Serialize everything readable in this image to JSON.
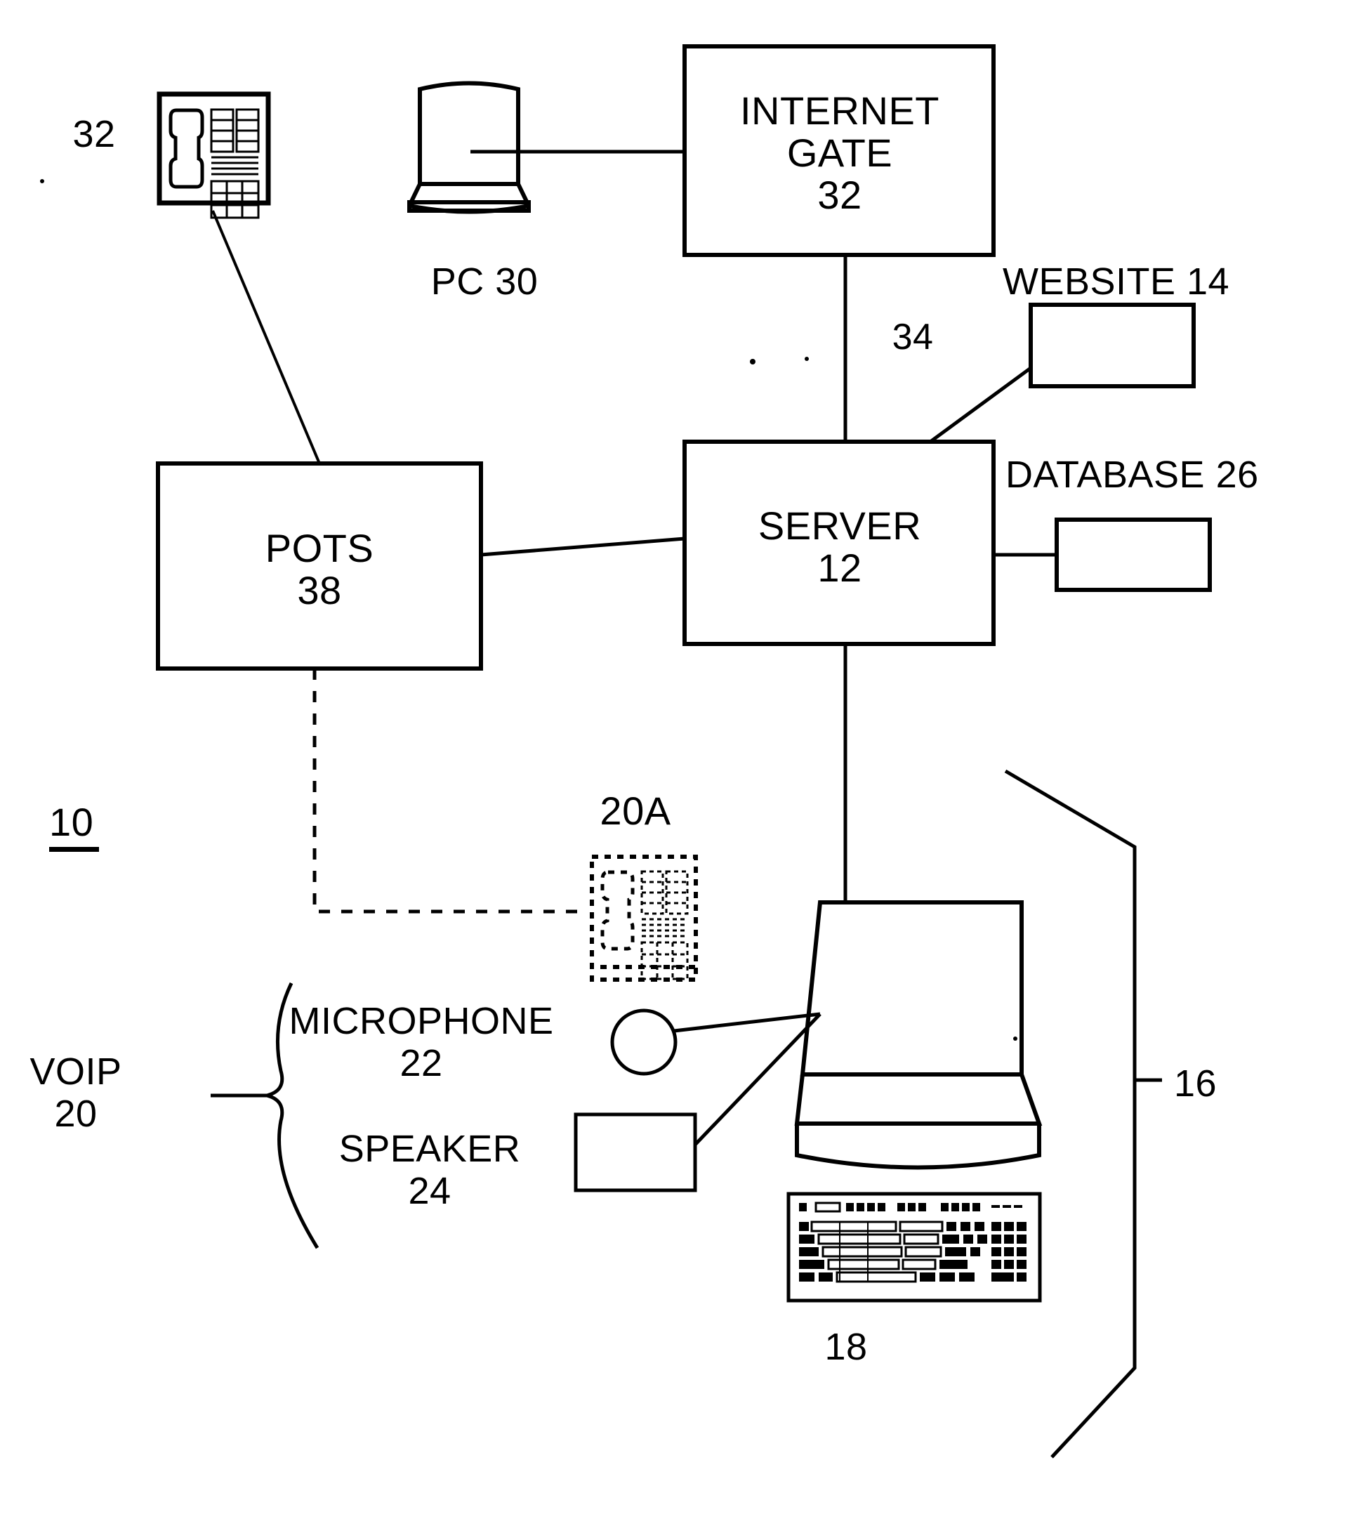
{
  "figure": {
    "reference_numeral": "10",
    "nodes": {
      "internet_gate": {
        "line1": "INTERNET",
        "line2": "GATE",
        "number": "32"
      },
      "server": {
        "line1": "SERVER",
        "number": "12"
      },
      "pots": {
        "line1": "POTS",
        "number": "38"
      },
      "website": {
        "label": "WEBSITE 14"
      },
      "database": {
        "label": "DATABASE 26"
      },
      "pc": {
        "label": "PC 30"
      },
      "phone_top": {
        "label": "32"
      },
      "phone_voip": {
        "label": "20A"
      },
      "voip": {
        "line1": "VOIP",
        "line2": "20"
      },
      "microphone": {
        "line1": "MICROPHONE",
        "line2": "22"
      },
      "speaker": {
        "line1": "SPEAKER",
        "line2": "24"
      },
      "keyboard": {
        "label": "18"
      },
      "terminal_bracket": {
        "label": "16"
      },
      "link_gate_server": {
        "label": "34"
      }
    },
    "colors": {
      "stroke": "#000000",
      "background": "#ffffff"
    }
  }
}
